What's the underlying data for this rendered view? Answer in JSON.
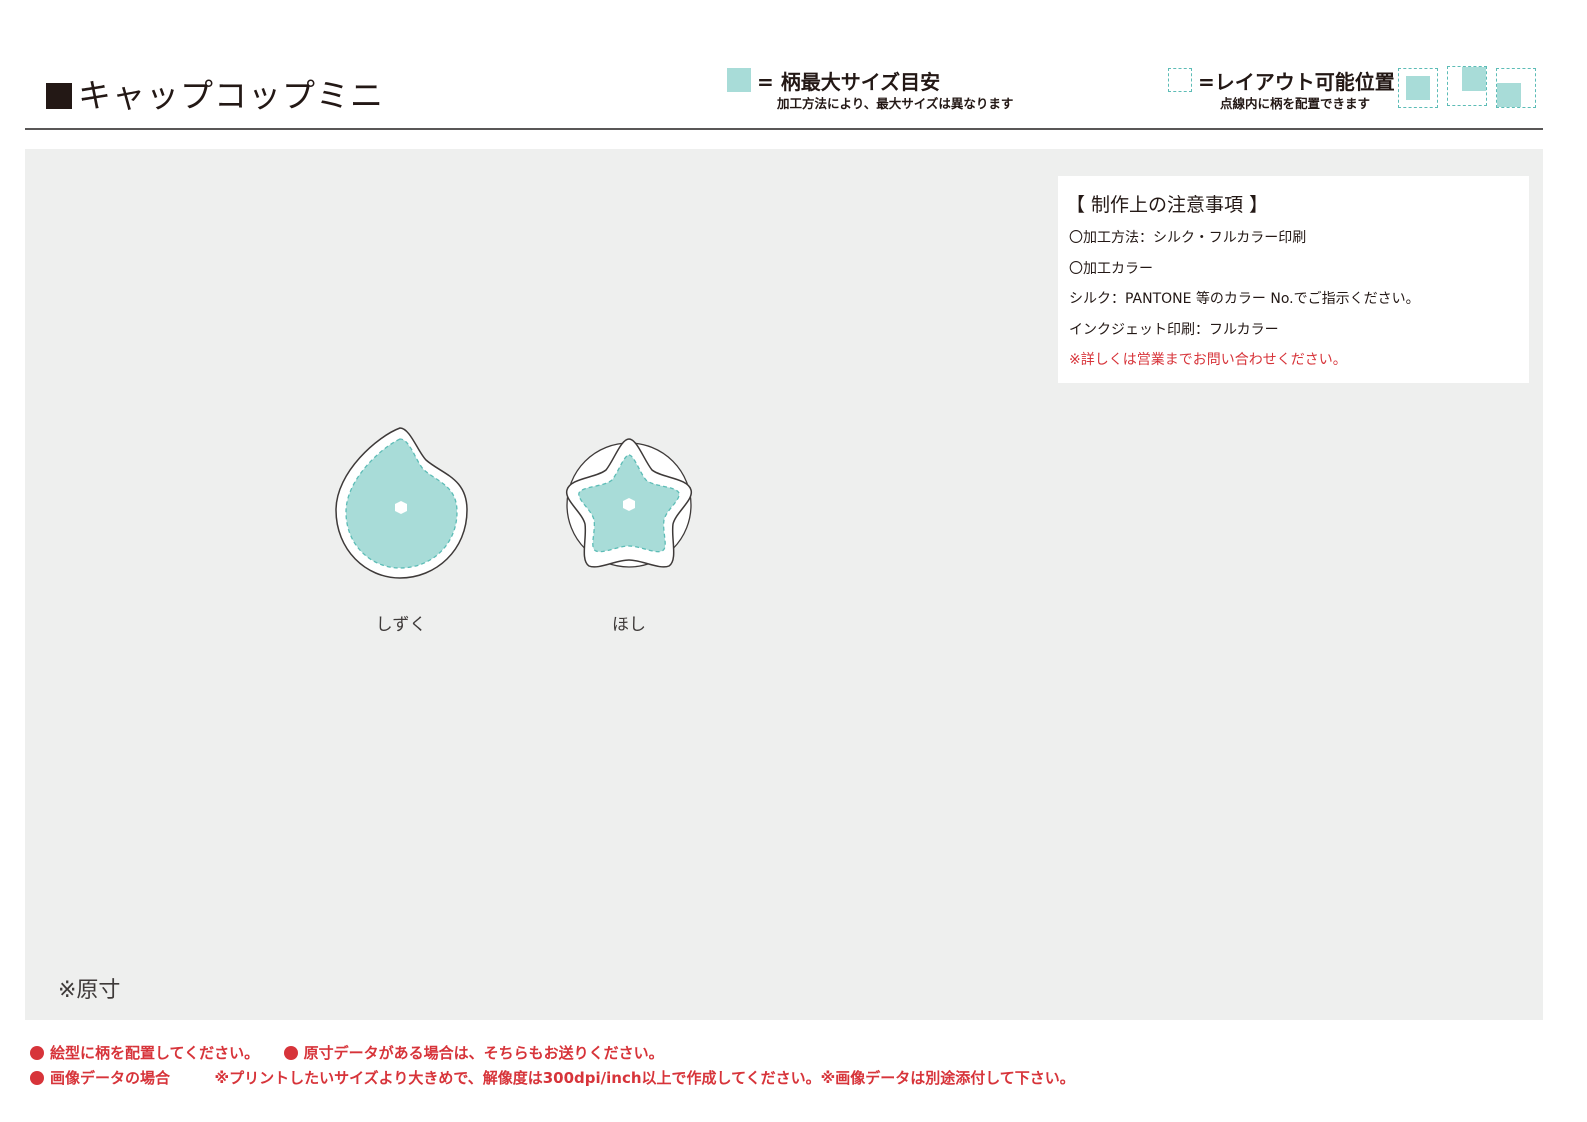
{
  "header": {
    "title": "キャップコップミニ",
    "legend_max_size": {
      "label": "= 柄最大サイズ目安",
      "note": "加工方法により、最大サイズは異なります"
    },
    "legend_layout": {
      "label": "=レイアウト可能位置",
      "note": "点線内に柄を配置できます"
    }
  },
  "notes": {
    "heading": "【 制作上の注意事項 】",
    "lines": [
      "〇加工方法：シルク・フルカラー印刷",
      "〇加工カラー",
      "シルク：PANTONE 等のカラー No.でご指示ください。",
      "インクジェット印刷：フルカラー"
    ],
    "warning": "※詳しくは営業までお問い合わせください。"
  },
  "shapes": [
    {
      "name": "drop",
      "label": "しずく"
    },
    {
      "name": "star",
      "label": "ほし"
    }
  ],
  "scale_note": "※原寸",
  "footer": {
    "line1_a": "絵型に柄を配置してください。",
    "line1_b": "原寸データがある場合は、そちらもお送りください。",
    "line2_a": "画像データの場合",
    "line2_b": "※プリントしたいサイズより大きめで、解像度は300dpi/inch以上で作成してください。※画像データは別途添付して下さい。"
  },
  "colors": {
    "print_area": "#a8dcd8",
    "dashed_outline": "#5cbcb6",
    "panel_bg": "#eeefee",
    "warning_red": "#d7343a"
  }
}
